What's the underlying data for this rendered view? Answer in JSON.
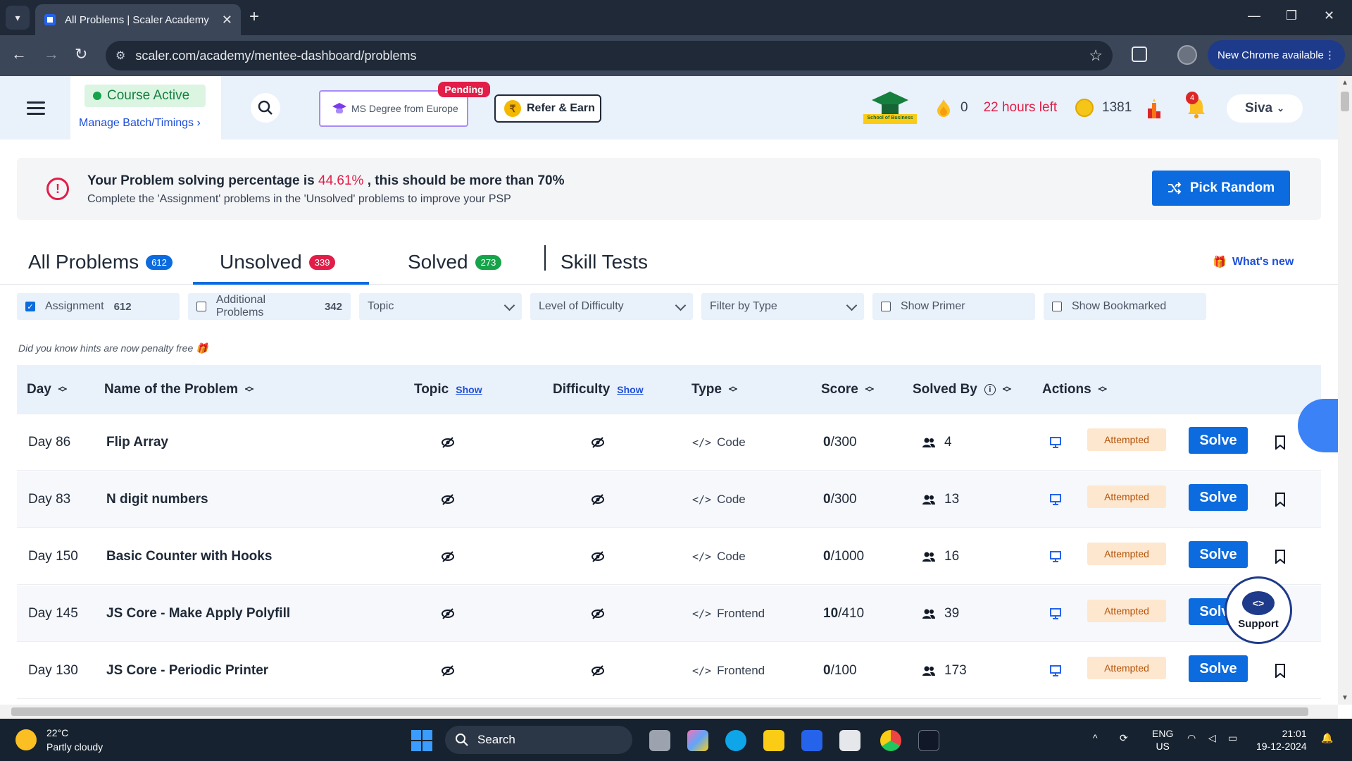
{
  "browser": {
    "tab_title": "All Problems | Scaler Academy",
    "url": "scaler.com/academy/mentee-dashboard/problems",
    "new_chrome_label": "New Chrome available"
  },
  "topnav": {
    "course_status": "Course Active",
    "manage_batch": "Manage Batch/Timings",
    "ms_degree_label": "MS Degree from Europe",
    "pending_badge": "Pending",
    "refer_earn_label": "Refer & Earn",
    "school_logo_text": "School of Business",
    "streak_count": "0",
    "hours_left": "22 hours left",
    "coins": "1381",
    "notifications_count": "4",
    "user_name": "Siva"
  },
  "psp_banner": {
    "line1_prefix": "Your Problem solving percentage is ",
    "percentage": "44.61%",
    "line1_suffix": " , this should be more than 70%",
    "line2": "Complete the 'Assignment' problems in the 'Unsolved' problems to improve your PSP",
    "pick_random_label": "Pick Random"
  },
  "tabs": [
    {
      "label": "All Problems",
      "count": "612",
      "badge_color": "#0b6bdf"
    },
    {
      "label": "Unsolved",
      "count": "339",
      "badge_color": "#e11d48"
    },
    {
      "label": "Solved",
      "count": "273",
      "badge_color": "#16a34a"
    },
    {
      "label": "Skill Tests"
    }
  ],
  "whats_new_label": "What's new",
  "filters": {
    "assignment_label": "Assignment",
    "assignment_count": "612",
    "assignment_checked": true,
    "additional_label": "Additional Problems",
    "additional_count": "342",
    "topic_placeholder": "Topic",
    "difficulty_placeholder": "Level of Difficulty",
    "type_placeholder": "Filter by Type",
    "show_primer_label": "Show Primer",
    "show_bookmarked_label": "Show Bookmarked"
  },
  "hint_text": "Did you know hints are now penalty free 🎁",
  "table": {
    "headers": {
      "day": "Day",
      "name": "Name of the Problem",
      "topic": "Topic",
      "difficulty": "Difficulty",
      "show_link": "Show",
      "type": "Type",
      "score": "Score",
      "solved_by": "Solved By",
      "actions": "Actions"
    },
    "status_label": "Attempted",
    "solve_label": "Solve",
    "rows": [
      {
        "day": "Day 86",
        "name": "Flip Array",
        "type": "Code",
        "score": "0",
        "max": "/300",
        "solved_by": "4"
      },
      {
        "day": "Day 83",
        "name": "N digit numbers",
        "type": "Code",
        "score": "0",
        "max": "/300",
        "solved_by": "13"
      },
      {
        "day": "Day 150",
        "name": "Basic Counter with Hooks",
        "type": "Code",
        "score": "0",
        "max": "/1000",
        "solved_by": "16"
      },
      {
        "day": "Day 145",
        "name": "JS Core - Make Apply Polyfill",
        "type": "Frontend",
        "score": "10",
        "max": "/410",
        "solved_by": "39"
      },
      {
        "day": "Day 130",
        "name": "JS Core - Periodic Printer",
        "type": "Frontend",
        "score": "0",
        "max": "/100",
        "solved_by": "173"
      }
    ]
  },
  "support_label": "Support",
  "taskbar": {
    "temperature": "22°C",
    "weather": "Partly cloudy",
    "search_label": "Search",
    "lang_line1": "ENG",
    "lang_line2": "US",
    "time": "21:01",
    "date": "19-12-2024"
  }
}
